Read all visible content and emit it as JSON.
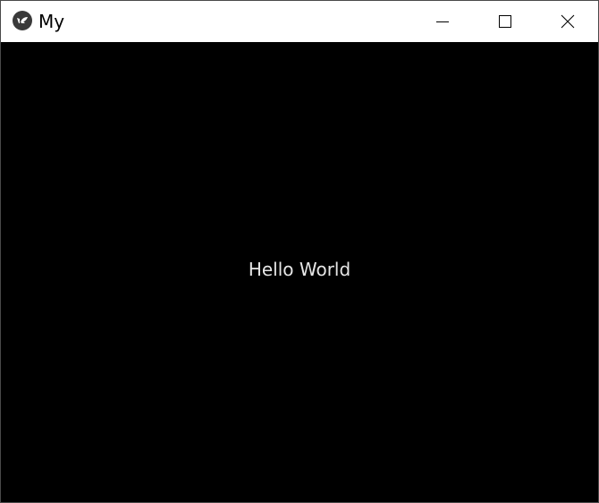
{
  "window": {
    "title": "My",
    "app_icon": "kivy-logo-icon",
    "controls": {
      "minimize_icon": "minimize-icon",
      "maximize_icon": "maximize-icon",
      "close_icon": "close-icon"
    }
  },
  "content": {
    "label": "Hello World"
  },
  "colors": {
    "titlebar_bg": "#ffffff",
    "client_bg": "#000000",
    "label_color": "#e6e6e6"
  }
}
